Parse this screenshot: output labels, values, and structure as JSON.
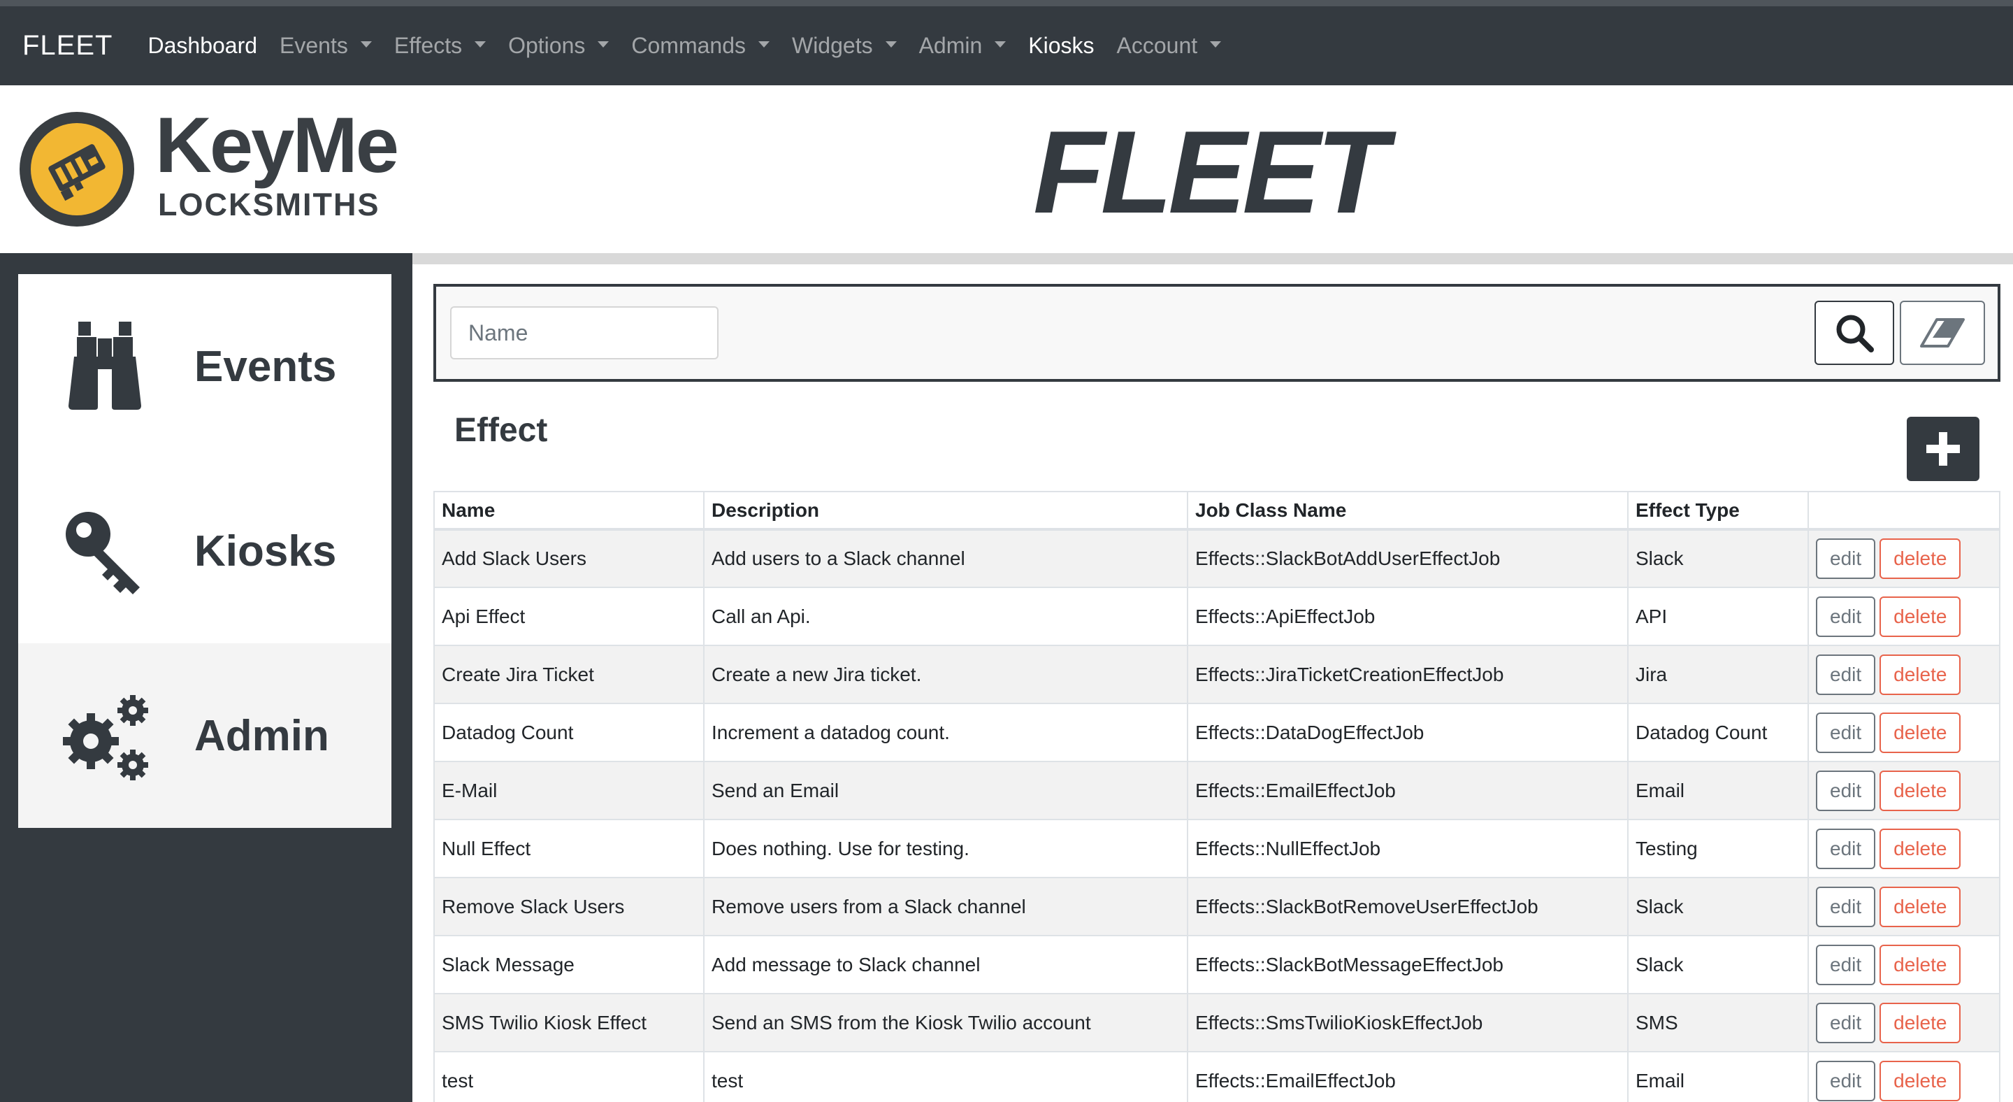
{
  "navbar": {
    "brand": "FLEET",
    "items": [
      {
        "label": "Dashboard",
        "dropdown": false,
        "active": true
      },
      {
        "label": "Events",
        "dropdown": true,
        "active": false
      },
      {
        "label": "Effects",
        "dropdown": true,
        "active": false
      },
      {
        "label": "Options",
        "dropdown": true,
        "active": false
      },
      {
        "label": "Commands",
        "dropdown": true,
        "active": false
      },
      {
        "label": "Widgets",
        "dropdown": true,
        "active": false
      },
      {
        "label": "Admin",
        "dropdown": true,
        "active": false
      },
      {
        "label": "Kiosks",
        "dropdown": false,
        "active": true
      },
      {
        "label": "Account",
        "dropdown": true,
        "active": false
      }
    ]
  },
  "header": {
    "logo_main": "KeyMe",
    "logo_sub": "LOCKSMITHS",
    "title": "FLEET",
    "logo_colors": {
      "ring": "#393e42",
      "fill": "#f2b733"
    }
  },
  "sidebar": {
    "items": [
      {
        "label": "Events",
        "icon": "binoculars-icon"
      },
      {
        "label": "Kiosks",
        "icon": "key-icon"
      },
      {
        "label": "Admin",
        "icon": "gears-icon"
      }
    ]
  },
  "filter": {
    "name_placeholder": "Name",
    "name_value": "",
    "search_icon": "search-icon",
    "clear_icon": "eraser-icon"
  },
  "section": {
    "title": "Effect",
    "add_icon": "plus-icon"
  },
  "table": {
    "headers": [
      "Name",
      "Description",
      "Job Class Name",
      "Effect Type",
      ""
    ],
    "edit_label": "edit",
    "delete_label": "delete",
    "rows": [
      {
        "name": "Add Slack Users",
        "description": "Add users to a Slack channel",
        "job": "Effects::SlackBotAddUserEffectJob",
        "type": "Slack"
      },
      {
        "name": "Api Effect",
        "description": "Call an Api.",
        "job": "Effects::ApiEffectJob",
        "type": "API"
      },
      {
        "name": "Create Jira Ticket",
        "description": "Create a new Jira ticket.",
        "job": "Effects::JiraTicketCreationEffectJob",
        "type": "Jira"
      },
      {
        "name": "Datadog Count",
        "description": "Increment a datadog count.",
        "job": "Effects::DataDogEffectJob",
        "type": "Datadog Count"
      },
      {
        "name": "E-Mail",
        "description": "Send an Email",
        "job": "Effects::EmailEffectJob",
        "type": "Email"
      },
      {
        "name": "Null Effect",
        "description": "Does nothing. Use for testing.",
        "job": "Effects::NullEffectJob",
        "type": "Testing"
      },
      {
        "name": "Remove Slack Users",
        "description": "Remove users from a Slack channel",
        "job": "Effects::SlackBotRemoveUserEffectJob",
        "type": "Slack"
      },
      {
        "name": "Slack Message",
        "description": "Add message to Slack channel",
        "job": "Effects::SlackBotMessageEffectJob",
        "type": "Slack"
      },
      {
        "name": "SMS Twilio Kiosk Effect",
        "description": "Send an SMS from the Kiosk Twilio account",
        "job": "Effects::SmsTwilioKioskEffectJob",
        "type": "SMS"
      },
      {
        "name": "test",
        "description": "test",
        "job": "Effects::EmailEffectJob",
        "type": "Email"
      }
    ]
  },
  "colors": {
    "navbar_bg": "#343a40",
    "delete_accent": "#e8634b",
    "logo_yellow": "#f2b733"
  }
}
